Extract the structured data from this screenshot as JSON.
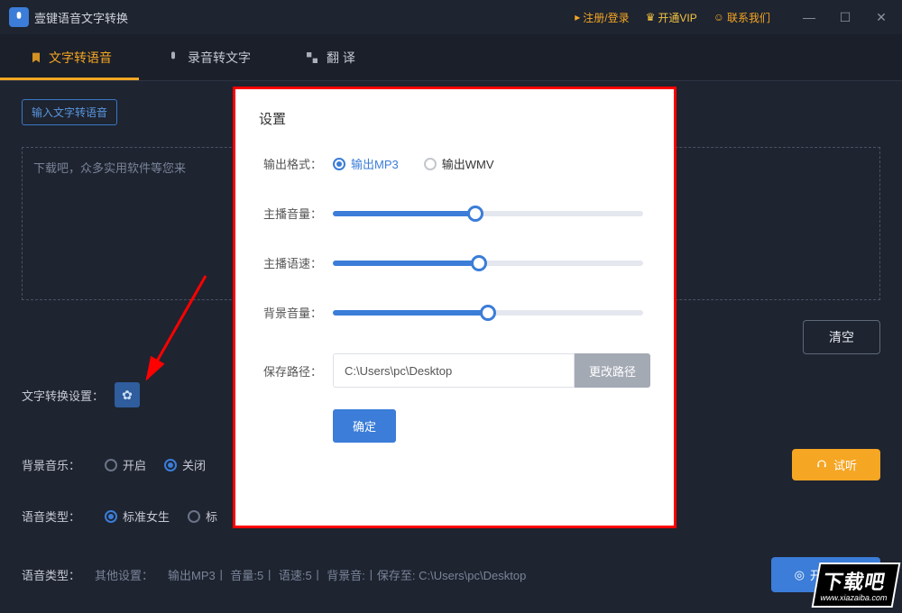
{
  "titlebar": {
    "app_name": "壹键语音文字转换",
    "links": {
      "login": "注册/登录",
      "vip": "开通VIP",
      "contact": "联系我们"
    }
  },
  "tabs": {
    "tts": "文字转语音",
    "stt": "录音转文字",
    "translate": "翻  译"
  },
  "main": {
    "sub_tab": "输入文字转语音",
    "placeholder": "下载吧，众多实用软件等您来",
    "clear": "清空",
    "settings_label": "文字转换设置：",
    "bg_music_label": "背景音乐：",
    "bg_music_on": "开启",
    "bg_music_off": "关闭",
    "voice_type_label": "语音类型：",
    "voice_type_female": "标准女生",
    "voice_type_std": "标",
    "listen": "试听",
    "start": "开始转换",
    "summary_label": "语音类型：",
    "summary_other": "其他设置：",
    "summary_value": "输出MP3丨 音量:5丨 语速:5丨 背景音:丨保存至: C:\\Users\\pc\\Desktop"
  },
  "dialog": {
    "title": "设置",
    "output_format_label": "输出格式：",
    "output_mp3": "输出MP3",
    "output_wmv": "输出WMV",
    "volume_label": "主播音量：",
    "speed_label": "主播语速：",
    "bg_volume_label": "背景音量：",
    "save_path_label": "保存路径：",
    "save_path_value": "C:\\Users\\pc\\Desktop",
    "change_path": "更改路径",
    "ok": "确定",
    "sliders": {
      "volume": 46,
      "speed": 47,
      "bg_volume": 50
    }
  },
  "watermark": {
    "main": "下载吧",
    "sub": "www.xiazaiba.com"
  }
}
